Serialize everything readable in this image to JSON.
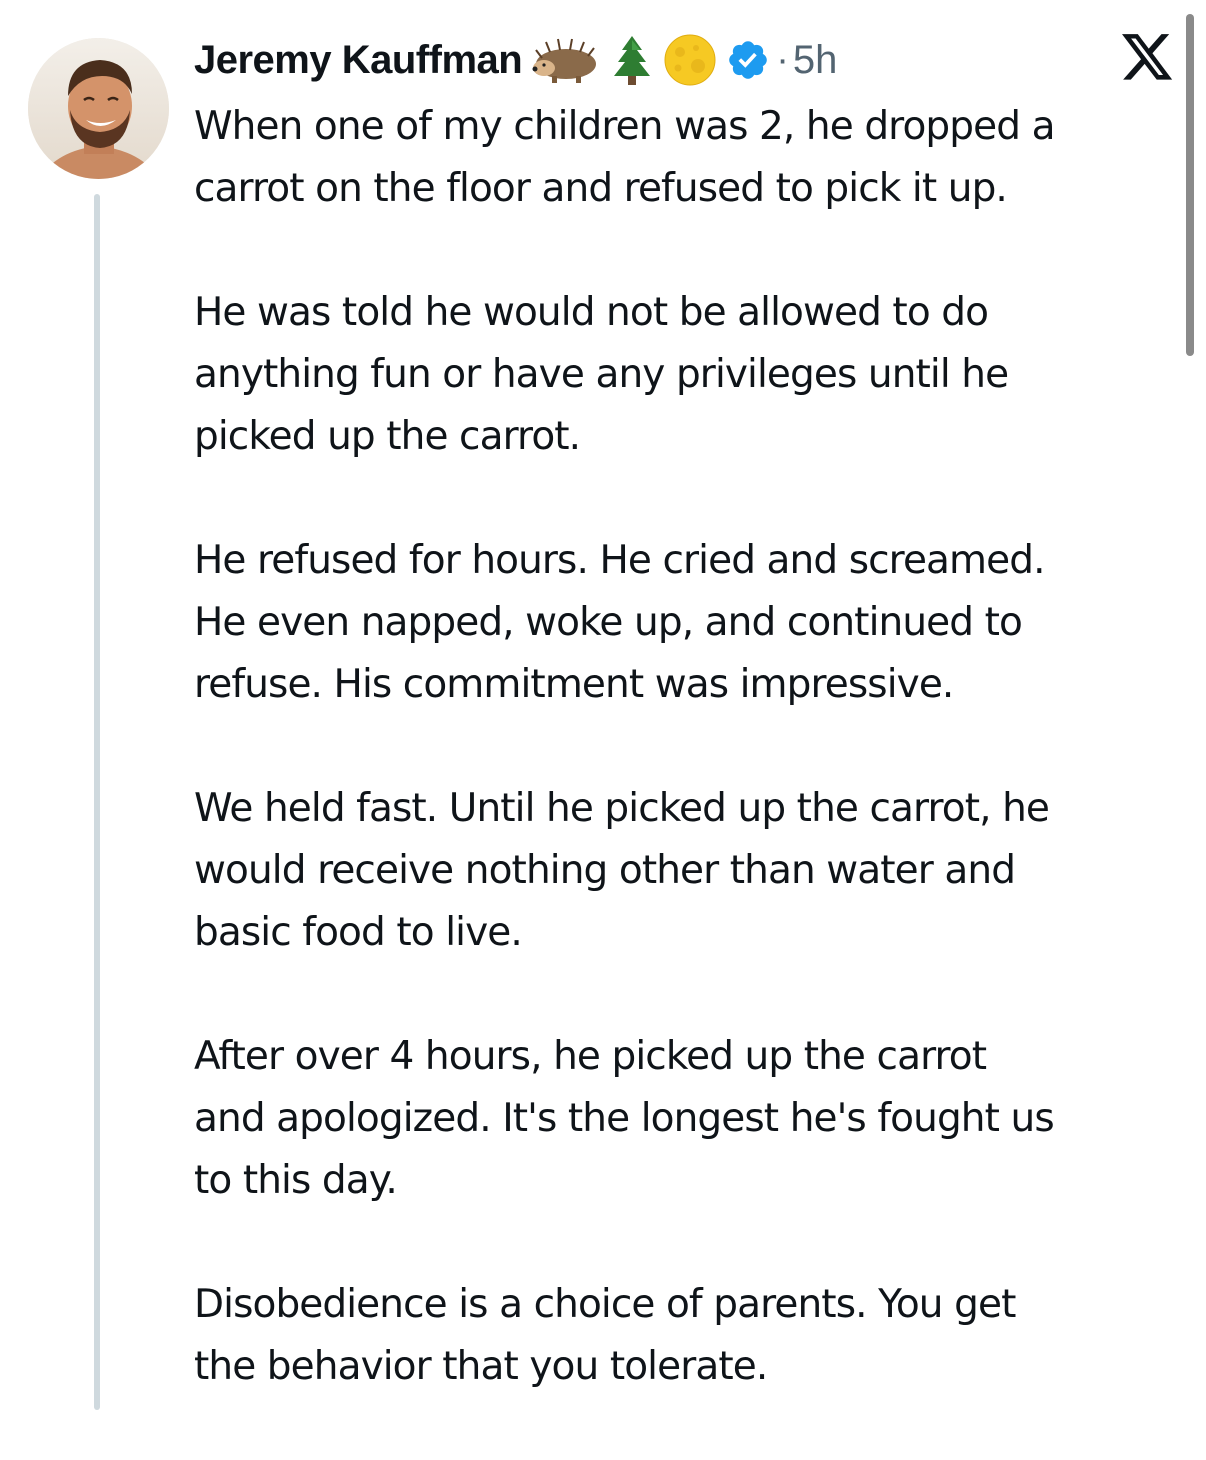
{
  "author": {
    "name": "Jeremy Kauffman",
    "emojis": [
      "hedgehog-emoji",
      "evergreen-tree-emoji",
      "full-moon-emoji"
    ],
    "verified": true,
    "separator": "·",
    "time": "5h"
  },
  "platform_logo": "x-logo-icon",
  "tweet": {
    "paragraphs": [
      [
        "When one of my children was 2, he dropped a",
        "carrot on the floor and refused to pick it up."
      ],
      [
        "He was told he would not be allowed to do",
        "anything fun or have any privileges until he",
        "picked up the carrot."
      ],
      [
        "He refused for hours. He cried and screamed.",
        "He even napped, woke up, and continued to",
        "refuse. His commitment was impressive."
      ],
      [
        "We held fast. Until he picked up the carrot, he",
        "would receive nothing other than water and",
        "basic food to live."
      ],
      [
        "After over 4 hours, he picked up the carrot",
        "and apologized. It's the longest he's fought us",
        "to this day."
      ],
      [
        "Disobedience is a choice of parents. You get",
        "the behavior that you tolerate."
      ]
    ]
  },
  "colors": {
    "text": "#0f1419",
    "secondary": "#536471",
    "verified_blue": "#1d9bf0",
    "thread_line": "#cfd9de"
  }
}
